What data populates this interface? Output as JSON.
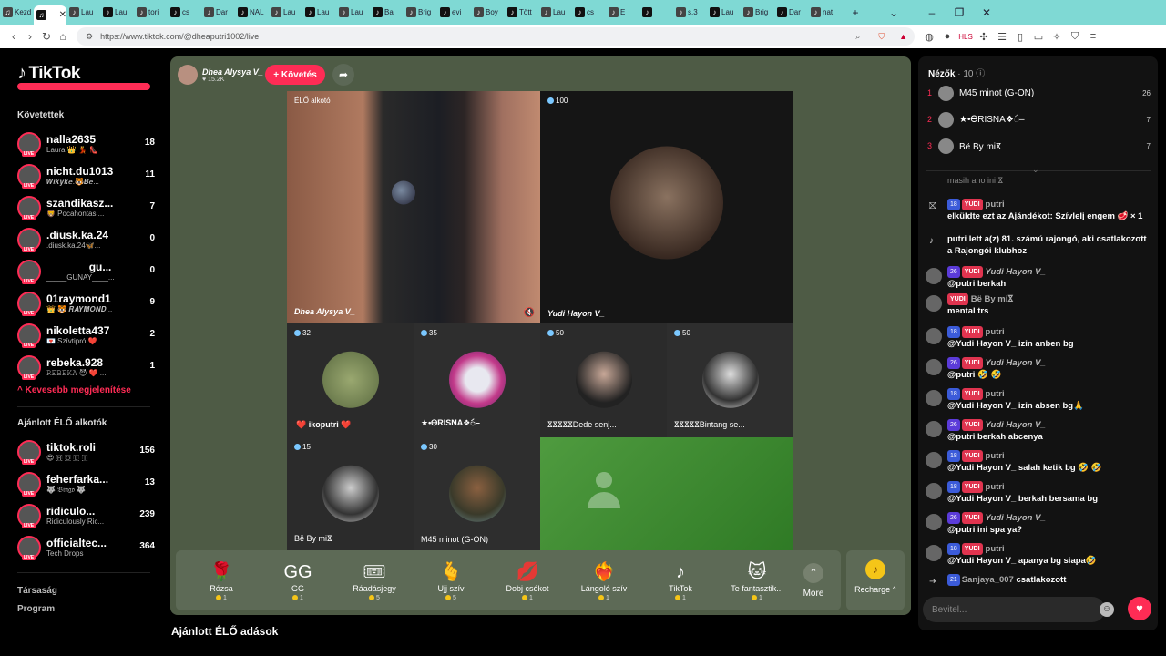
{
  "browser": {
    "tabs": [
      {
        "title": "Kezdés",
        "fav": "♫"
      },
      {
        "title": "",
        "fav": "♫"
      },
      {
        "title": "Lau",
        "fav": "♪"
      },
      {
        "title": "Lau",
        "fav": "♪"
      },
      {
        "title": "tori",
        "fav": "♪"
      },
      {
        "title": "cs",
        "fav": "♪"
      },
      {
        "title": "Dar",
        "fav": "♪"
      },
      {
        "title": "NAL",
        "fav": "♪"
      },
      {
        "title": "Lau",
        "fav": "♪"
      },
      {
        "title": "Lau",
        "fav": "♪"
      },
      {
        "title": "Lau",
        "fav": "♪"
      },
      {
        "title": "Bal",
        "fav": "♪"
      },
      {
        "title": "Brig",
        "fav": "♪"
      },
      {
        "title": "evi",
        "fav": "♪"
      },
      {
        "title": "Boy",
        "fav": "♪"
      },
      {
        "title": "Tött",
        "fav": "♪"
      },
      {
        "title": "Lau",
        "fav": "♪"
      },
      {
        "title": "cs",
        "fav": "♪"
      },
      {
        "title": "E",
        "fav": "♪"
      },
      {
        "title": "",
        "fav": "♪"
      },
      {
        "title": "s.3",
        "fav": "♪"
      },
      {
        "title": "Lau",
        "fav": "♪"
      },
      {
        "title": "Brig",
        "fav": "♪"
      },
      {
        "title": "Dar",
        "fav": "♪"
      },
      {
        "title": "nat",
        "fav": "♪"
      }
    ],
    "url": "https://www.tiktok.com/@dheaputri1002/live",
    "new_tab": "+"
  },
  "sidebar": {
    "logo": "TikTok",
    "following_title": "Követettek",
    "following": [
      {
        "name": "nalla2635",
        "sub": "Laura 👑 💃 👠",
        "count": "18"
      },
      {
        "name": "nicht.du1013",
        "sub": "𝑾𝒊𝒌𝒚𝒌𝒆.🐯𝑩𝒆...",
        "count": "11"
      },
      {
        "name": "szandikasz...",
        "sub": "🦁 Pocahontas ...",
        "count": "7"
      },
      {
        "name": ".diusk.ka.24",
        "sub": ".diusk.ka.24🦋...",
        "count": "0"
      },
      {
        "name": "_______gu...",
        "sub": "_____GUNAY____...",
        "count": "0"
      },
      {
        "name": "01raymond1",
        "sub": "👑 🐯 𝑹𝑨𝒀𝑴𝑶𝑵𝑫...",
        "count": "9"
      },
      {
        "name": "nikoletta437",
        "sub": "💌 Szívtipró ❤️ ...",
        "count": "2"
      },
      {
        "name": "rebeka.928",
        "sub": "𝚁𝙴𝙱𝙴𝙺𝙰 😈 ❤️ ...",
        "count": "1"
      }
    ],
    "show_less": "^ Kevesebb megjelenítése",
    "suggested_title": "Ajánlott ÉLŐ alkotók",
    "suggested": [
      {
        "name": "tiktok.roli",
        "sub": "😎 🇷 🇴 🇱 🇮",
        "count": "156"
      },
      {
        "name": "feherfarka...",
        "sub": "🐺 𝔅𝔦𝔫𝔤𝔬 🐺",
        "count": "13"
      },
      {
        "name": "ridiculo...",
        "sub": "Ridiculously Ric...",
        "count": "239"
      },
      {
        "name": "officialtec...",
        "sub": "Tech Drops",
        "count": "364"
      }
    ],
    "footer": [
      "Társaság",
      "Program"
    ]
  },
  "stage": {
    "host_name": "Dhea Alysya V_",
    "host_likes": "♥ 15.2K",
    "follow_label": "+ Követés",
    "cells": [
      {
        "badge": "ÉLŐ alkotó",
        "caption": "Dhea Alysya V_"
      },
      {
        "badge": "100",
        "caption": "Yudi Hayon V_"
      },
      {
        "badge": "32",
        "caption": "❤️ ikoputri ❤️"
      },
      {
        "badge": "35",
        "caption": "★•ᎾRISNA❖ဴ–"
      },
      {
        "badge": "50",
        "caption": "𐋀𐋀𐋀𐋀𐋀Dede senj..."
      },
      {
        "badge": "50",
        "caption": "𐋀𐋀𐋀𐋀𐋀Bintang se..."
      },
      {
        "badge": "15",
        "caption": "Bë By mi𐋀"
      },
      {
        "badge": "30",
        "caption": "M45 minot (G-ON)"
      }
    ],
    "gifts": [
      {
        "name": "Rózsa",
        "icon": "🌹",
        "price": "1"
      },
      {
        "name": "GG",
        "icon": "GG",
        "price": "1"
      },
      {
        "name": "Ráadásjegy",
        "icon": "🎟",
        "price": "5"
      },
      {
        "name": "Ujj szív",
        "icon": "🫰",
        "price": "5"
      },
      {
        "name": "Dobj csókot",
        "icon": "💋",
        "price": "1"
      },
      {
        "name": "Lángoló szív",
        "icon": "❤️‍🔥",
        "price": "1"
      },
      {
        "name": "TikTok",
        "icon": "♪",
        "price": "1"
      },
      {
        "name": "Te fantasztik...",
        "icon": "🐱",
        "price": "1"
      }
    ],
    "more_label": "More",
    "recharge_label": "Recharge ^"
  },
  "recommended_title": "Ajánlott ÉLŐ adások",
  "viewers": {
    "title": "Nézők",
    "count": "· 10",
    "list": [
      {
        "rank": "1",
        "name": "M45 minot (G-ON)",
        "score": "26"
      },
      {
        "rank": "2",
        "name": "★•ᎾRISNA❖ဴ–",
        "score": "7"
      },
      {
        "rank": "3",
        "name": "Bë By mi𐋀",
        "score": "7"
      }
    ]
  },
  "chat": [
    {
      "user": "masih ano ini 𐋀",
      "text": "",
      "lv": "",
      "fan": ""
    },
    {
      "lv": "18",
      "fan": "YUDI",
      "user": "putri",
      "text": "elküldte ezt az Ajándékot: Szívlelj engem 🥩 × 1"
    },
    {
      "lv": "",
      "fan": "",
      "user": "",
      "text": "putri lett a(z) 81. számú rajongó, aki csatlakozott a Rajongói klubhoz"
    },
    {
      "lv": "26",
      "fan": "YUDI",
      "user": "Yudi Hayon V_",
      "text": "@putri berkah"
    },
    {
      "lv": "",
      "fan": "YUDI",
      "user": "Bë By mi𐋀",
      "text": "mental trs"
    },
    {
      "lv": "18",
      "fan": "YUDI",
      "user": "putri",
      "text": "@Yudi Hayon V_ izin anben bg"
    },
    {
      "lv": "26",
      "fan": "YUDI",
      "user": "Yudi Hayon V_",
      "text": "@putri 🤣 🤣"
    },
    {
      "lv": "18",
      "fan": "YUDI",
      "user": "putri",
      "text": "@Yudi Hayon V_ izin absen bg🙏"
    },
    {
      "lv": "26",
      "fan": "YUDI",
      "user": "Yudi Hayon V_",
      "text": "@putri berkah abcenya"
    },
    {
      "lv": "18",
      "fan": "YUDI",
      "user": "putri",
      "text": "@Yudi Hayon V_ salah ketik bg 🤣 🤣"
    },
    {
      "lv": "18",
      "fan": "YUDI",
      "user": "putri",
      "text": "@Yudi Hayon V_ berkah bersama bg"
    },
    {
      "lv": "26",
      "fan": "YUDI",
      "user": "Yudi Hayon V_",
      "text": "@putri ini spa ya?"
    },
    {
      "lv": "18",
      "fan": "YUDI",
      "user": "putri",
      "text": "@Yudi Hayon V_ apanya bg siapa🤣"
    },
    {
      "lv": "21",
      "fan": "",
      "user": "Sanjaya_007",
      "text": "csatlakozott"
    }
  ],
  "input_placeholder": "Bevitel...",
  "colors": {
    "brand": "#fe2c55",
    "stage": "#4e5b45",
    "tabbar": "#7fd9d4"
  }
}
